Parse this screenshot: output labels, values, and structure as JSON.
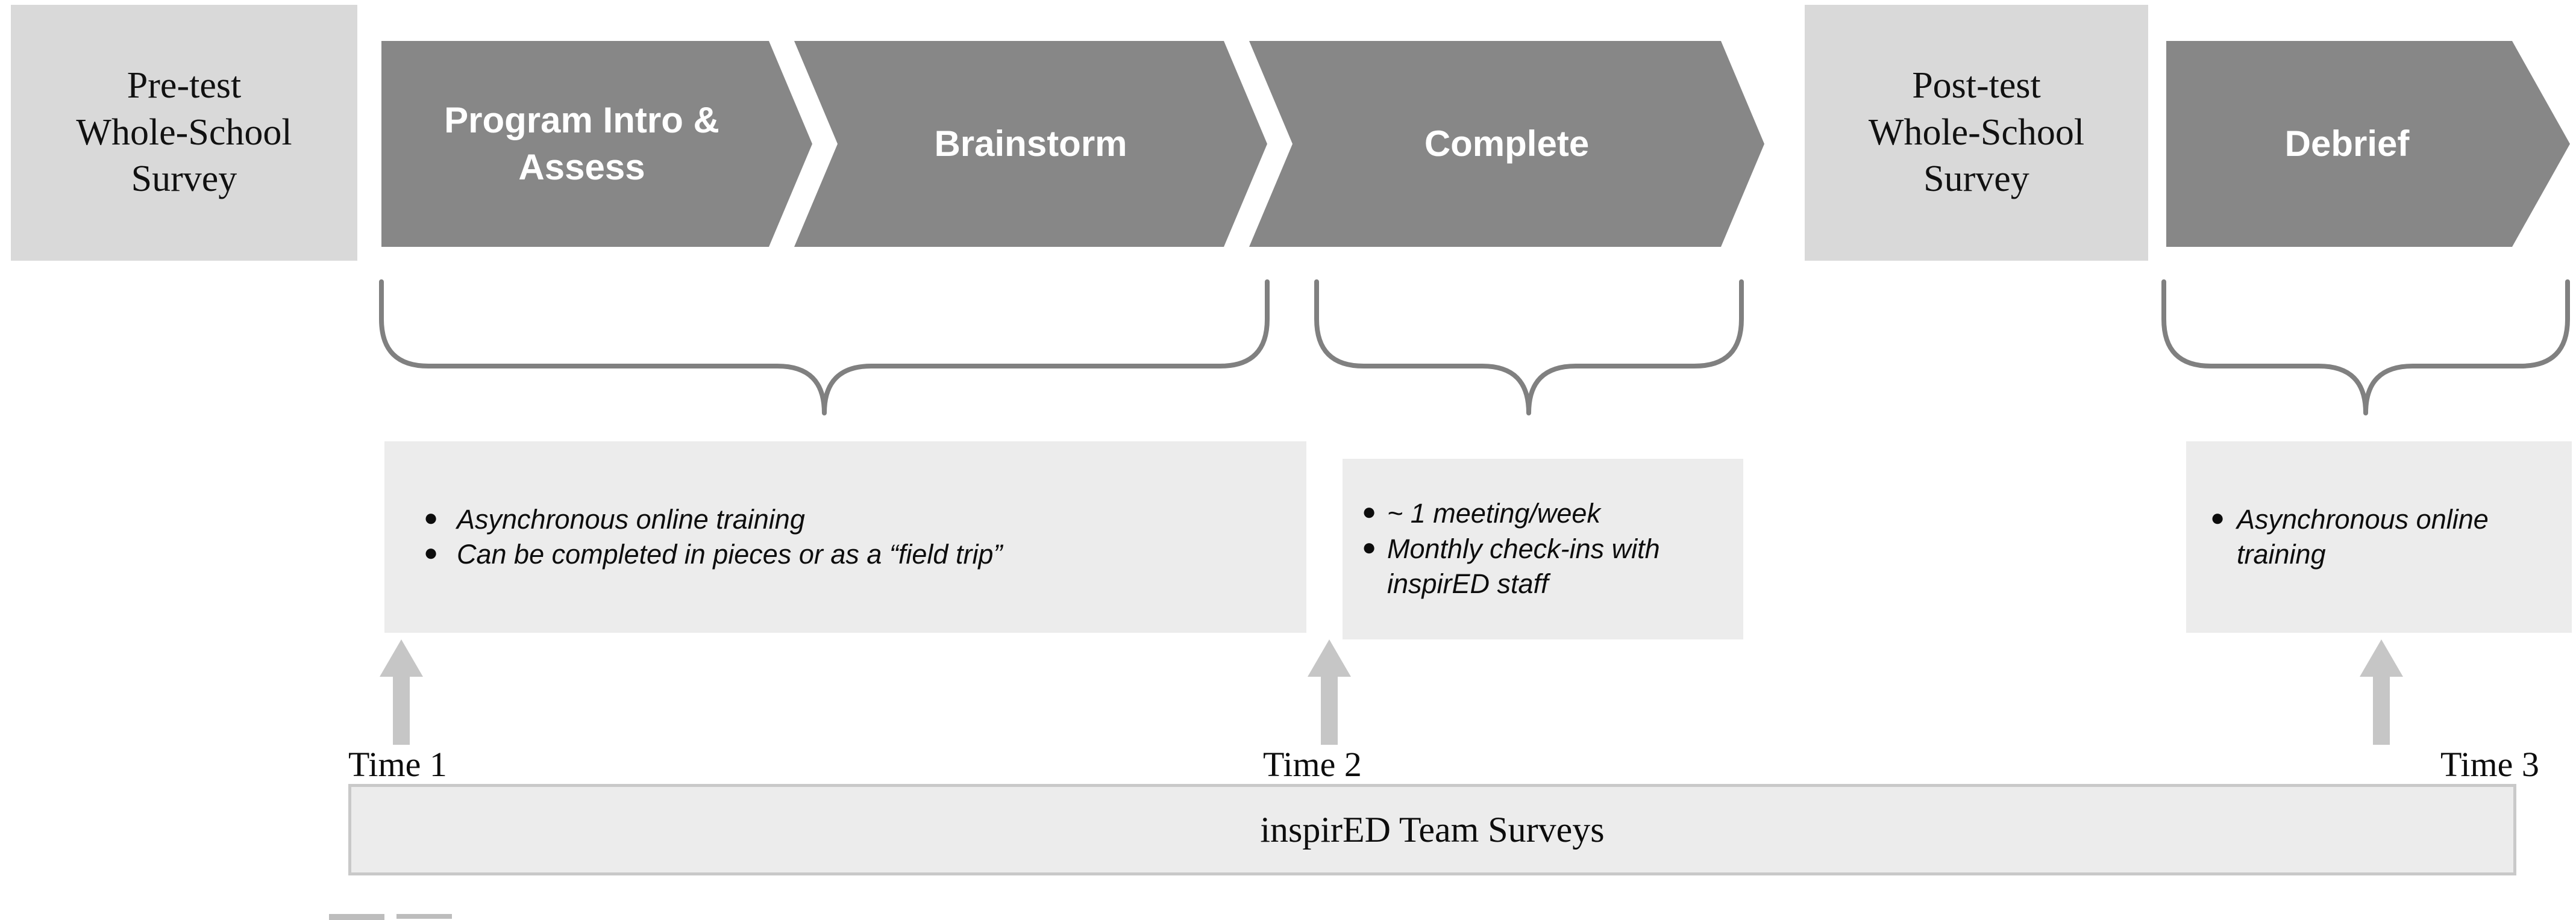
{
  "theme": {
    "page_background": "#ffffff",
    "survey_box_fill": "#d9d9d9",
    "chevron_fill": "#878787",
    "chevron_text": "#ffffff",
    "note_box_fill": "#ececec",
    "brace_stroke": "#808080",
    "arrow_fill": "#c6c6c6",
    "bar_fill": "#ececec",
    "bar_border": "#c9c9c9",
    "body_text": "#0d0d0d"
  },
  "timeline": {
    "pre_test": {
      "label": "Pre-test\nWhole-School\nSurvey"
    },
    "post_test": {
      "label": "Post-test\nWhole-School\nSurvey"
    },
    "stages": [
      {
        "label": "Program Intro &\nAssess"
      },
      {
        "label": "Brainstorm"
      },
      {
        "label": "Complete"
      }
    ],
    "debrief": {
      "label": "Debrief"
    }
  },
  "notes": [
    {
      "name": "intro-assess-brainstorm-notes",
      "bullets": [
        "Asynchronous online training",
        "Can be completed in pieces or as a “field trip”"
      ]
    },
    {
      "name": "complete-notes",
      "bullets": [
        "~ 1 meeting/week",
        "Monthly check-ins with inspirED staff"
      ]
    },
    {
      "name": "debrief-notes",
      "bullets": [
        "Asynchronous online training"
      ]
    }
  ],
  "measurement_points": [
    {
      "label": "Time 1"
    },
    {
      "label": "Time 2"
    },
    {
      "label": "Time 3"
    }
  ],
  "survey_bar": {
    "label": "inspirED Team Surveys"
  },
  "icons": {
    "bullet": "●",
    "up_arrow": "up-arrow-icon",
    "brace": "curly-brace-icon"
  }
}
